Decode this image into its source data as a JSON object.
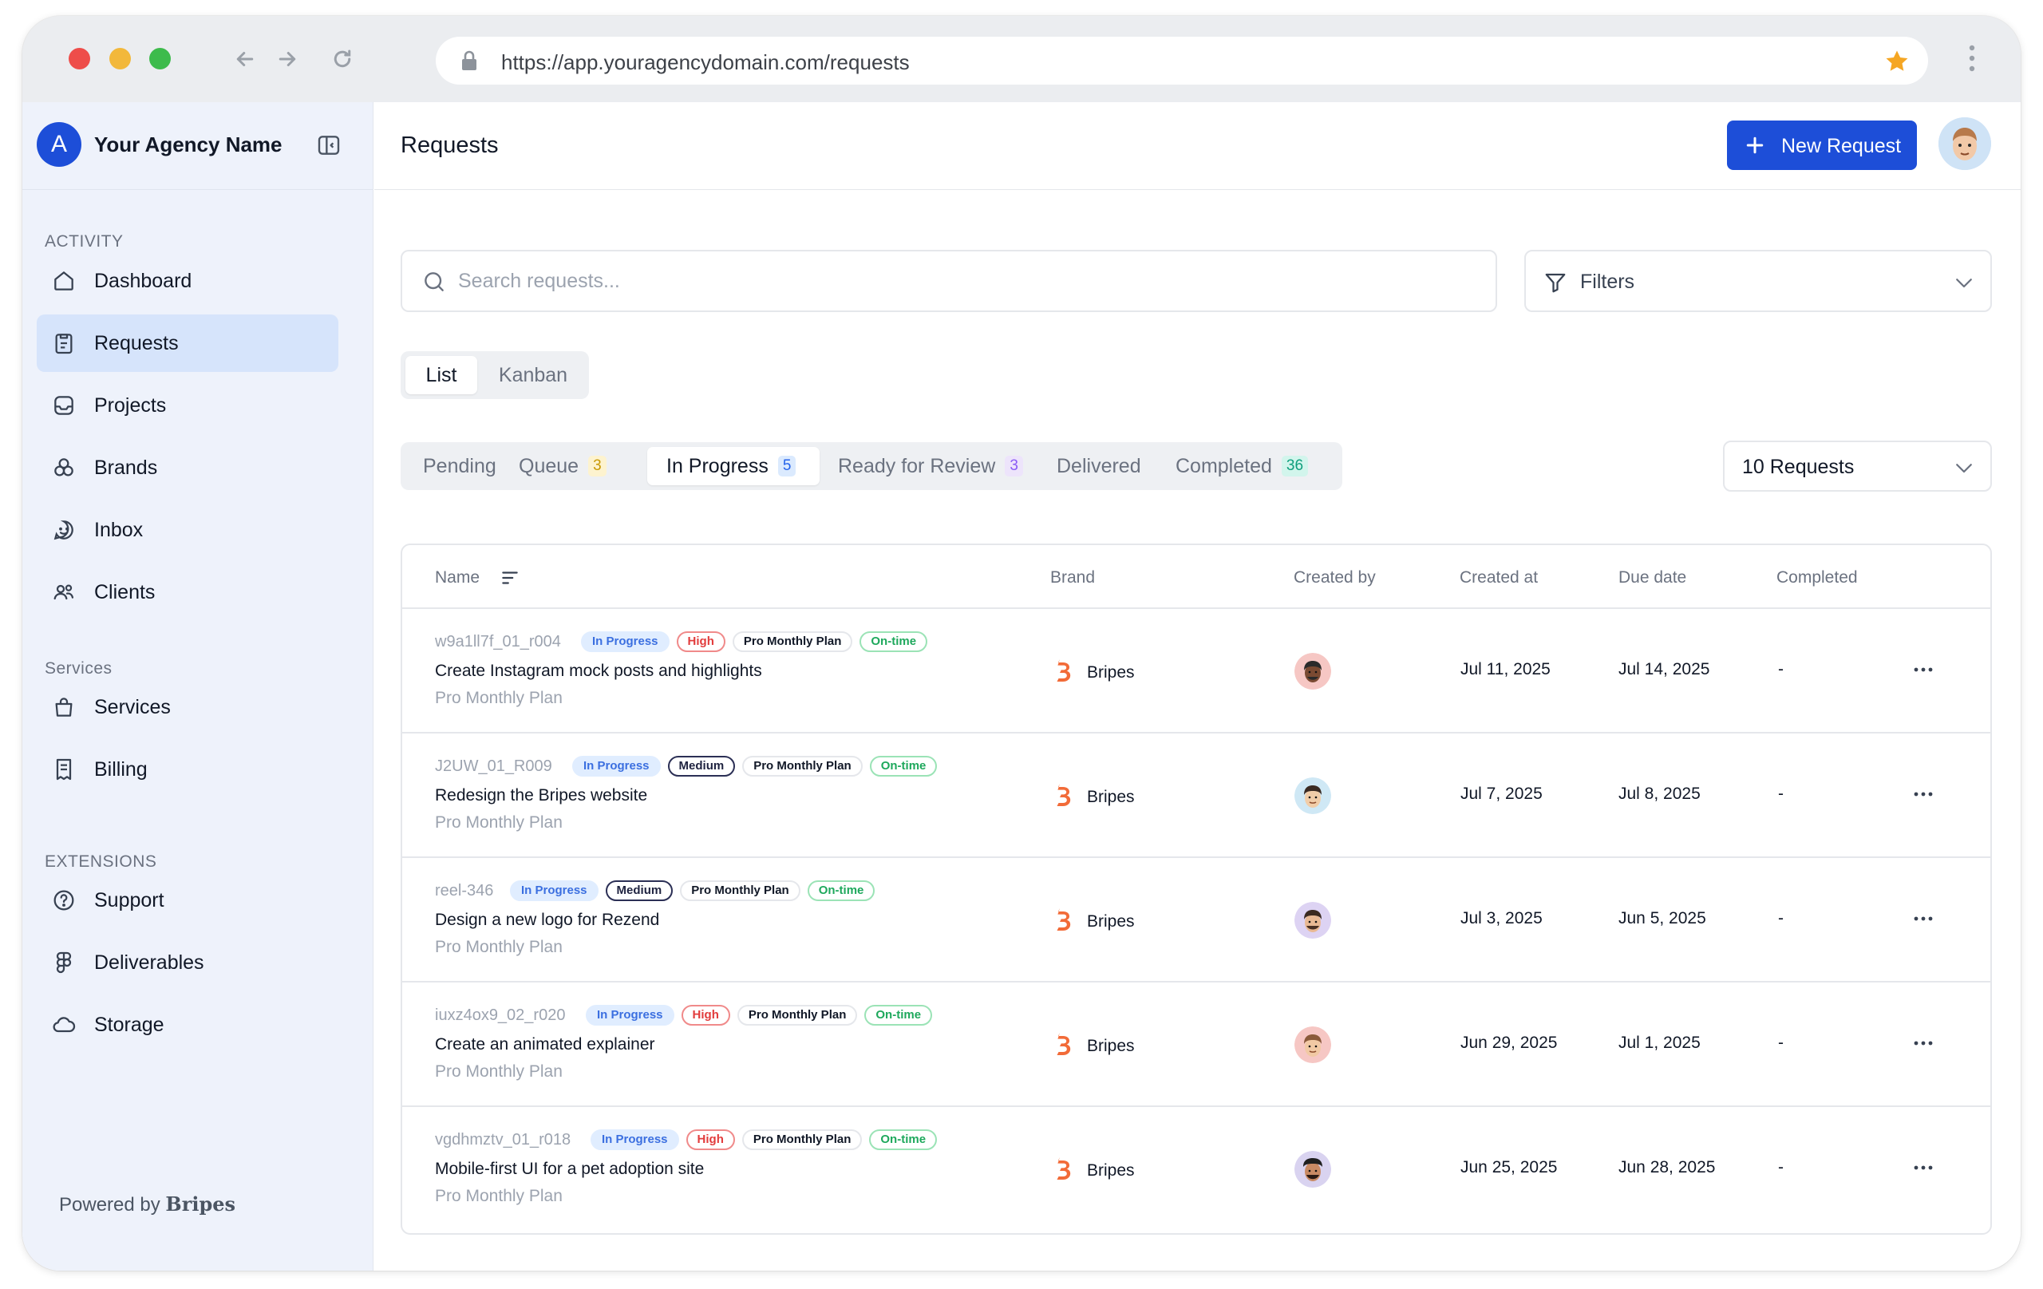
{
  "browser": {
    "url": "https://app.youragencydomain.com/requests"
  },
  "sidebar": {
    "agency_initial": "A",
    "agency_name": "Your Agency Name",
    "sections": {
      "activity": "ACTIVITY",
      "services": "Services",
      "extensions": "EXTENSIONS"
    },
    "items": [
      {
        "label": "Dashboard",
        "icon": "home-icon"
      },
      {
        "label": "Requests",
        "icon": "clipboard-icon",
        "active": true
      },
      {
        "label": "Projects",
        "icon": "inbox-tray-icon"
      },
      {
        "label": "Brands",
        "icon": "brands-icon"
      },
      {
        "label": "Inbox",
        "icon": "chat-icon"
      },
      {
        "label": "Clients",
        "icon": "users-icon"
      },
      {
        "label": "Services",
        "icon": "bag-icon"
      },
      {
        "label": "Billing",
        "icon": "receipt-icon"
      },
      {
        "label": "Support",
        "icon": "help-icon"
      },
      {
        "label": "Deliverables",
        "icon": "figma-icon"
      },
      {
        "label": "Storage",
        "icon": "cloud-icon"
      }
    ],
    "powered_by": "Powered by",
    "powered_brand": "Bripes"
  },
  "header": {
    "title": "Requests",
    "new_button": "New Request"
  },
  "search": {
    "placeholder": "Search requests..."
  },
  "filters": {
    "label": "Filters"
  },
  "view_toggle": {
    "list": "List",
    "kanban": "Kanban"
  },
  "status_tabs": [
    {
      "label": "Pending",
      "count": ""
    },
    {
      "label": "Queue",
      "count": "3"
    },
    {
      "label": "In Progress",
      "count": "5"
    },
    {
      "label": "Ready for Review",
      "count": "3"
    },
    {
      "label": "Delivered",
      "count": ""
    },
    {
      "label": "Completed",
      "count": "36"
    }
  ],
  "page_size": {
    "label": "10 Requests"
  },
  "table": {
    "columns": {
      "name": "Name",
      "brand": "Brand",
      "created_by": "Created by",
      "created_at": "Created at",
      "due_date": "Due date",
      "completed": "Completed"
    },
    "rows": [
      {
        "id": "w9a1ll7f_01_r004",
        "status": "In Progress",
        "priority": "High",
        "plan": "Pro Monthly Plan",
        "timing": "On-time",
        "title": "Create Instagram mock posts and highlights",
        "plan_sub": "Pro Monthly Plan",
        "brand": "Bripes",
        "created_at": "Jul 11, 2025",
        "due_date": "Jul 14, 2025",
        "completed": "-"
      },
      {
        "id": "J2UW_01_R009",
        "status": "In Progress",
        "priority": "Medium",
        "plan": "Pro Monthly Plan",
        "timing": "On-time",
        "title": "Redesign the Bripes website",
        "plan_sub": "Pro Monthly Plan",
        "brand": "Bripes",
        "created_at": "Jul 7, 2025",
        "due_date": "Jul 8, 2025",
        "completed": "-"
      },
      {
        "id": "reel-346",
        "status": "In Progress",
        "priority": "Medium",
        "plan": "Pro Monthly Plan",
        "timing": "On-time",
        "title": "Design a new logo for Rezend",
        "plan_sub": "Pro Monthly Plan",
        "brand": "Bripes",
        "created_at": "Jul 3, 2025",
        "due_date": "Jun 5, 2025",
        "completed": "-"
      },
      {
        "id": "iuxz4ox9_02_r020",
        "status": "In Progress",
        "priority": "High",
        "plan": "Pro Monthly Plan",
        "timing": "On-time",
        "title": "Create an animated explainer",
        "plan_sub": "Pro Monthly Plan",
        "brand": "Bripes",
        "created_at": "Jun 29, 2025",
        "due_date": "Jul 1, 2025",
        "completed": "-"
      },
      {
        "id": "vgdhmztv_01_r018",
        "status": "In Progress",
        "priority": "High",
        "plan": "Pro Monthly Plan",
        "timing": "On-time",
        "title": "Mobile-first UI for a pet adoption site",
        "plan_sub": "Pro Monthly Plan",
        "brand": "Bripes",
        "created_at": "Jun 25, 2025",
        "due_date": "Jun 28, 2025",
        "completed": "-"
      }
    ]
  },
  "colors": {
    "accent": "#1d4ed8",
    "sidebar_bg": "#eef2fb",
    "active_item": "#d6e4fb",
    "brand_logo": "#f26b38"
  }
}
